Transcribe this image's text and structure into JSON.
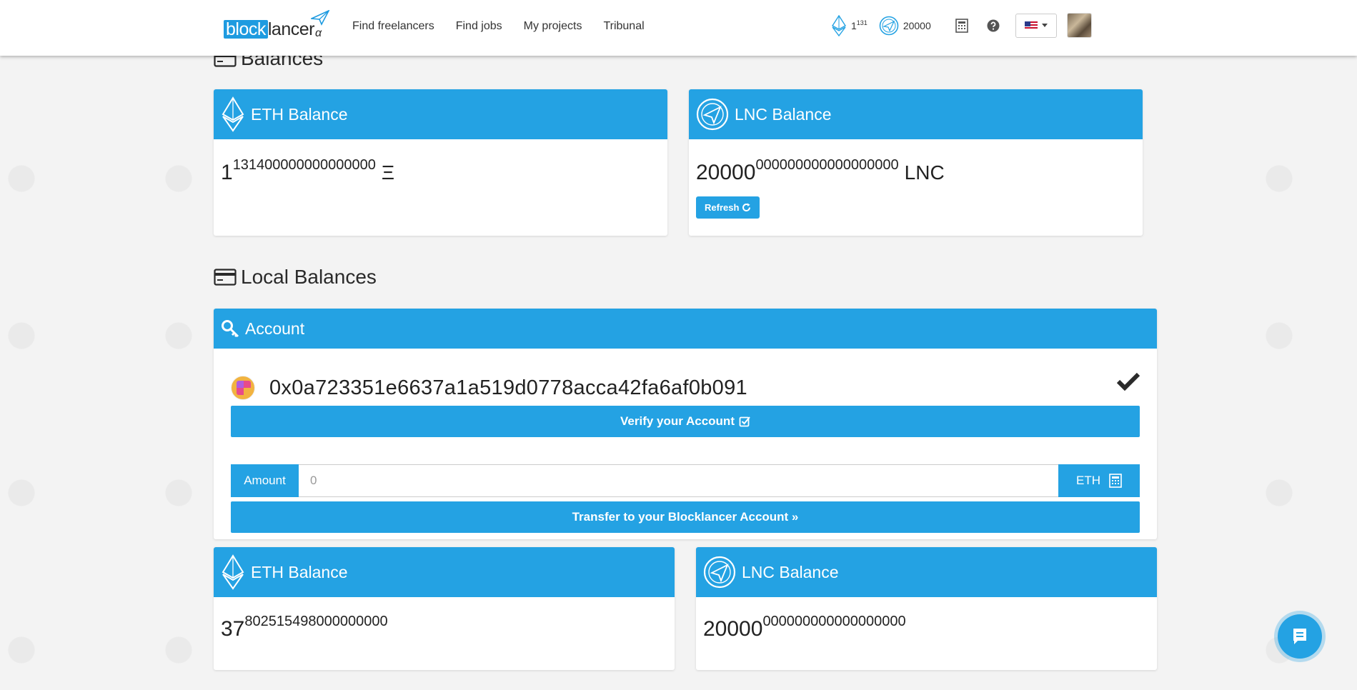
{
  "nav": {
    "logo": {
      "block": "block",
      "lancer": "lancer",
      "alpha": "α"
    },
    "links": [
      "Find freelancers",
      "Find jobs",
      "My projects",
      "Tribunal"
    ],
    "eth_balance": {
      "base": "1",
      "sup": "131"
    },
    "lnc_balance": "20000",
    "colors": {
      "accent": "#24a2e3"
    }
  },
  "balances": {
    "title": "Balances",
    "eth": {
      "label": "ETH Balance",
      "base": "1",
      "sup": "131400000000000000",
      "unit": "Ξ"
    },
    "lnc": {
      "label": "LNC Balance",
      "base": "20000",
      "sup": "000000000000000000",
      "unit": "LNC",
      "refresh_label": "Refresh"
    }
  },
  "local": {
    "title": "Local Balances",
    "account": {
      "label": "Account",
      "address": "0x0a723351e6637a1a519d0778acca42fa6af0b091",
      "verify_label": "Verify your Account",
      "amount_label": "Amount",
      "amount_placeholder": "0",
      "amount_unit": "ETH",
      "transfer_label": "Transfer to your Blocklancer Account »"
    },
    "eth": {
      "label": "ETH Balance",
      "base": "37",
      "sup": "802515498000000000"
    },
    "lnc": {
      "label": "LNC Balance",
      "base": "20000",
      "sup": "000000000000000000"
    }
  }
}
